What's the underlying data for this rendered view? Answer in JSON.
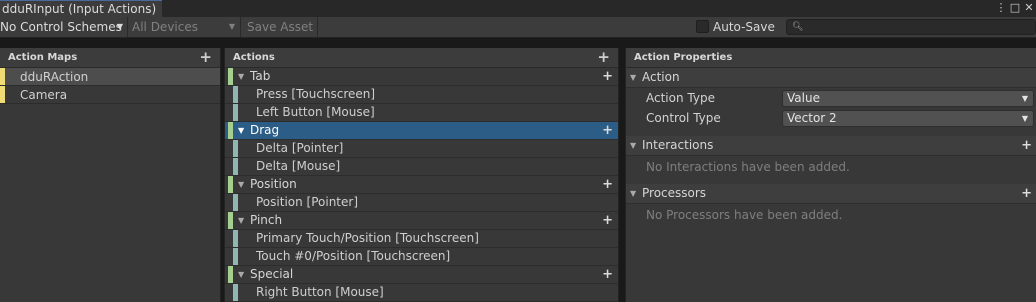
{
  "window": {
    "title": "dduRInput (Input Actions)"
  },
  "titlebar_icons": [
    "menu-dots-icon",
    "maximize-icon",
    "close-icon"
  ],
  "toolbar": {
    "control_schemes": "No Control Schemes",
    "devices": "All Devices",
    "save_asset": "Save Asset",
    "auto_save": "Auto-Save",
    "auto_save_checked": false,
    "search_value": ""
  },
  "action_maps": {
    "header": "Action Maps",
    "items": [
      {
        "label": "dduRAction",
        "selected": true
      },
      {
        "label": "Camera",
        "selected": false
      }
    ]
  },
  "actions": {
    "header": "Actions",
    "rows": [
      {
        "kind": "action",
        "label": "Tab"
      },
      {
        "kind": "binding",
        "label": "Press [Touchscreen]"
      },
      {
        "kind": "binding",
        "label": "Left Button [Mouse]"
      },
      {
        "kind": "action",
        "label": "Drag",
        "selected": true
      },
      {
        "kind": "binding",
        "label": "Delta [Pointer]"
      },
      {
        "kind": "binding",
        "label": "Delta [Mouse]"
      },
      {
        "kind": "action",
        "label": "Position"
      },
      {
        "kind": "binding",
        "label": "Position [Pointer]"
      },
      {
        "kind": "action",
        "label": "Pinch"
      },
      {
        "kind": "binding",
        "label": "Primary Touch/Position [Touchscreen]"
      },
      {
        "kind": "binding",
        "label": "Touch #0/Position [Touchscreen]"
      },
      {
        "kind": "action",
        "label": "Special"
      },
      {
        "kind": "binding",
        "label": "Right Button [Mouse]"
      }
    ]
  },
  "properties": {
    "header": "Action Properties",
    "action_section": "Action",
    "action_type_label": "Action Type",
    "action_type_value": "Value",
    "control_type_label": "Control Type",
    "control_type_value": "Vector 2",
    "interactions_section": "Interactions",
    "interactions_empty": "No Interactions have been added.",
    "processors_section": "Processors",
    "processors_empty": "No Processors have been added."
  },
  "colors": {
    "selection": "#2c5d87",
    "action_map_bar": "#f0dc75",
    "action_bar": "#a4cf8f",
    "binding_bar": "#8fb6b3"
  }
}
